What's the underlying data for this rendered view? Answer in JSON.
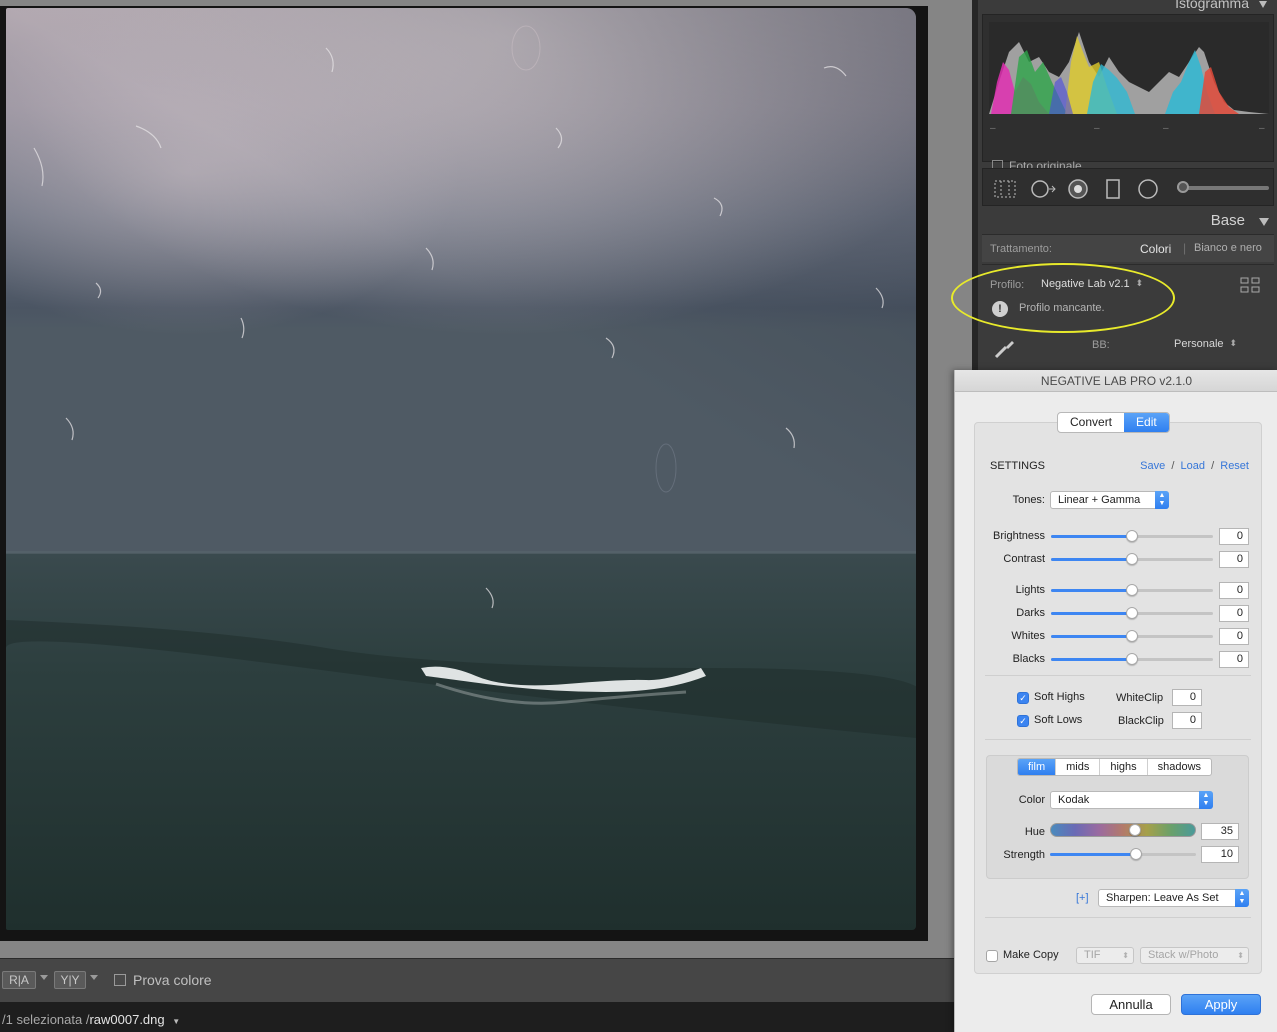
{
  "histogram": {
    "title": "Istogramma",
    "original_photo_label": "Foto originale",
    "tick_marks": [
      "–",
      "–",
      "–",
      "–"
    ]
  },
  "base_panel": {
    "title": "Base",
    "treatment_label": "Trattamento:",
    "treatment_options": [
      "Colori",
      "Bianco e nero"
    ],
    "profile_label": "Profilo:",
    "profile_value": "Negative Lab v2.1",
    "warning_text": "Profilo mancante.",
    "wb_label": "BB:",
    "wb_value": "Personale"
  },
  "toolbar": {
    "buttons": [
      "R|A",
      "Y|Y"
    ],
    "soft_proof_label": "Prova colore"
  },
  "status": {
    "prefix": "/1 selezionata /",
    "filename": "raw0007.dng"
  },
  "nlp": {
    "title": "NEGATIVE LAB PRO v2.1.0",
    "mode_tabs": [
      "Convert",
      "Edit"
    ],
    "active_mode": "Edit",
    "settings_label": "SETTINGS",
    "links": [
      "Save",
      "Load",
      "Reset"
    ],
    "tones_label": "Tones:",
    "tones_value": "Linear + Gamma",
    "sliders": [
      {
        "label": "Brightness",
        "value": "0",
        "level": 0.5
      },
      {
        "label": "Contrast",
        "value": "0",
        "level": 0.5
      },
      {
        "label": "Lights",
        "value": "0",
        "level": 0.5
      },
      {
        "label": "Darks",
        "value": "0",
        "level": 0.5
      },
      {
        "label": "Whites",
        "value": "0",
        "level": 0.5
      },
      {
        "label": "Blacks",
        "value": "0",
        "level": 0.5
      }
    ],
    "soft_highs_label": "Soft Highs",
    "soft_lows_label": "Soft Lows",
    "soft_highs_checked": true,
    "soft_lows_checked": true,
    "whiteclip_label": "WhiteClip",
    "whiteclip_value": "0",
    "blackclip_label": "BlackClip",
    "blackclip_value": "0",
    "color_tabs": [
      "film",
      "mids",
      "highs",
      "shadows"
    ],
    "active_color_tab": "film",
    "color_label": "Color",
    "color_value": "Kodak",
    "hue_label": "Hue",
    "hue_value": "35",
    "hue_level": 0.58,
    "strength_label": "Strength",
    "strength_value": "10",
    "strength_level": 0.59,
    "plus_label": "[+]",
    "sharpen_value": "Sharpen: Leave As Set",
    "make_copy_label": "Make Copy",
    "make_copy_checked": false,
    "copy_format": "TIF",
    "copy_mode": "Stack w/Photo",
    "cancel_label": "Annulla",
    "apply_label": "Apply"
  },
  "colors": {
    "accent": "#2f7ff0",
    "highlight_ellipse": "#e8ea2b"
  }
}
